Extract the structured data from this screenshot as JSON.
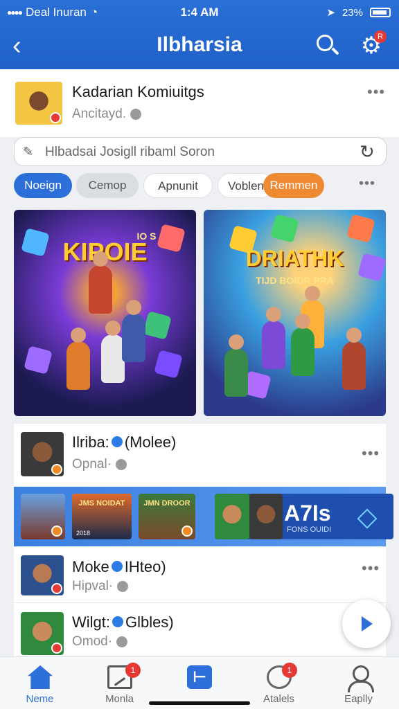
{
  "status_bar": {
    "carrier": "Deal Inuran",
    "time": "1:4 AM",
    "battery": "23%"
  },
  "header": {
    "title": "Ilbharsia",
    "gear_badge": "R"
  },
  "profile": {
    "name": "Kadarian Komiuitgs",
    "subtitle": "Ancitayd."
  },
  "search": {
    "placeholder": "Hlbadsai Josigll ribaml Soron"
  },
  "chips": [
    "Noeign",
    "Cemop",
    "Apnunit",
    "Voblen",
    "Remmen"
  ],
  "feature": {
    "left_title": "KIPOIE",
    "left_sub": "IO S",
    "right_title": "DRIATHK",
    "right_sub": "TIJD BOIDR PRA"
  },
  "feed": [
    {
      "name": "Ilriba:",
      "handle": "(Molee)",
      "sub": "Opnal·"
    },
    {
      "name": "Moke",
      "handle": "IHteo)",
      "sub": "Hipval·"
    },
    {
      "name": "Wilgt:",
      "handle": "Glbles)",
      "sub": "Omod·"
    }
  ],
  "strip": {
    "thumb2_caption": "JMS NOIDAT",
    "thumb2_year": "2018",
    "thumb3_caption": "JMN DROOR",
    "promo_title": "A7Is",
    "promo_sub": "FONS OUIDI"
  },
  "tabs": [
    {
      "label": "Neme"
    },
    {
      "label": "Monla",
      "badge": "1"
    },
    {
      "label": ""
    },
    {
      "label": "Atalels",
      "badge": "1"
    },
    {
      "label": "Eaplly"
    }
  ],
  "colors": {
    "brand": "#2d6fd8",
    "accent_orange": "#f08a32",
    "badge_red": "#e53935"
  }
}
